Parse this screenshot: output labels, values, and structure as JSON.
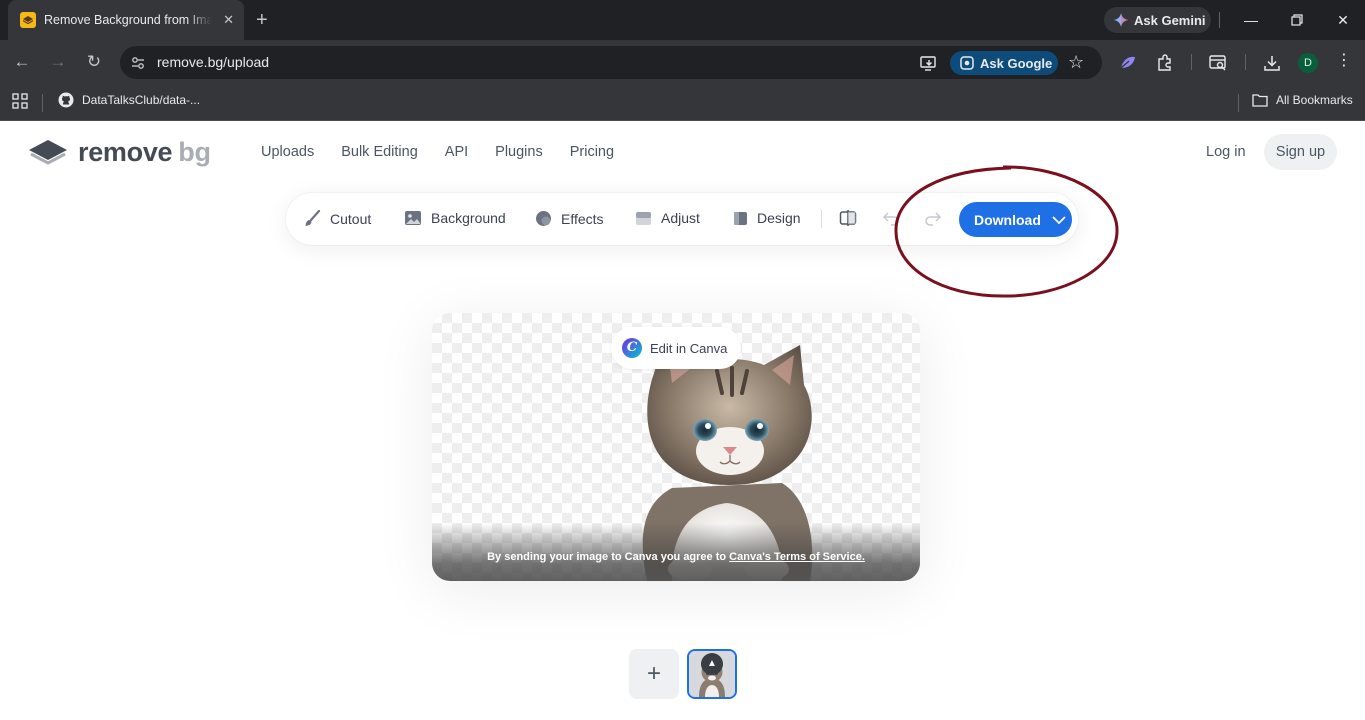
{
  "browser": {
    "tab_title": "Remove Background from Image",
    "ask_gemini": "Ask Gemini",
    "url": "remove.bg/upload",
    "ask_google": "Ask Google",
    "profile_initial": "D",
    "bookmark_1": "DataTalksClub/data-...",
    "all_bookmarks": "All Bookmarks"
  },
  "site": {
    "logo_main": "remove",
    "logo_accent": "bg",
    "nav": [
      "Uploads",
      "Bulk Editing",
      "API",
      "Plugins",
      "Pricing"
    ],
    "login": "Log in",
    "signup": "Sign up"
  },
  "editor": {
    "tools": [
      "Cutout",
      "Background",
      "Effects",
      "Adjust",
      "Design"
    ],
    "download": "Download",
    "edit_in_canva": "Edit in Canva",
    "terms_prefix": "By sending your image to Canva you agree to ",
    "terms_link": "Canva's Terms of Service.",
    "add_symbol": "+"
  },
  "colors": {
    "primary": "#1f6fe5",
    "annotation": "#7a0f1e",
    "chrome_dark": "#202124",
    "chrome_mid": "#35363a"
  }
}
